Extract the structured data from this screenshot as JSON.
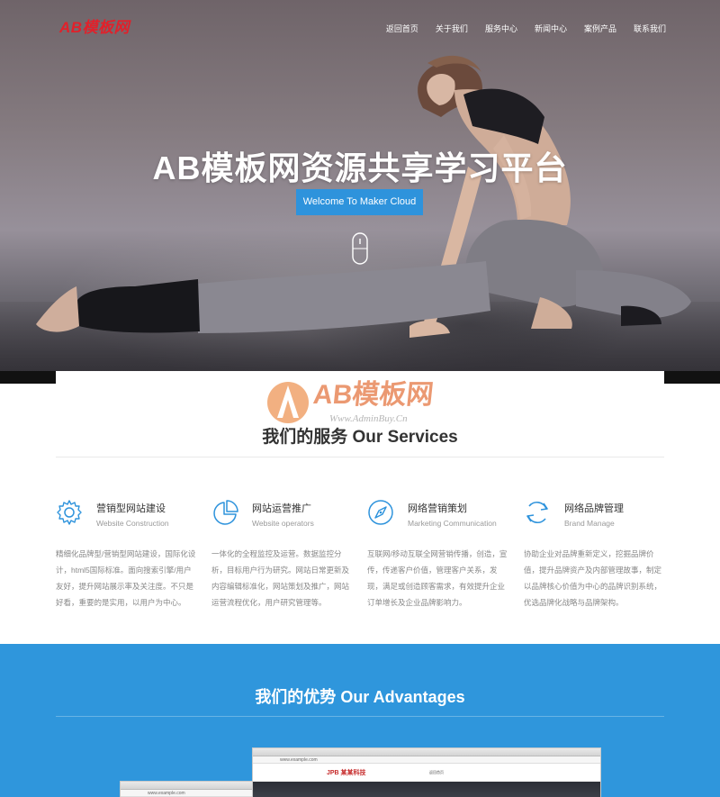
{
  "header": {
    "logo": "AB模板网",
    "nav": [
      "返回首页",
      "关于我们",
      "服务中心",
      "新闻中心",
      "案例产品",
      "联系我们"
    ]
  },
  "hero": {
    "title": "AB模板网资源共享学习平台",
    "button": "Welcome To Maker Cloud"
  },
  "watermark": {
    "brand": "AB模板网",
    "url": "Www.AdminBuy.Cn"
  },
  "services": {
    "title": "我们的服务 Our Services",
    "items": [
      {
        "icon": "gear-icon",
        "title": "营销型网站建设",
        "subtitle": "Website Construction",
        "desc": "精细化品牌型/营销型网站建设，国际化设计，html5国际标准。面向搜索引擎/用户友好，提升网站展示率及关注度。不只是好看，重要的是实用，以用户为中心。"
      },
      {
        "icon": "pie-chart-icon",
        "title": "网站运营推广",
        "subtitle": "Website operators",
        "desc": "一体化的全程监控及运营。数据监控分析，目标用户行为研究。网站日常更新及内容编辑标准化，网站策划及推广，网站运营流程优化，用户研究管理等。"
      },
      {
        "icon": "compass-icon",
        "title": "网络营销策划",
        "subtitle": "Marketing Communication",
        "desc": "互联网/移动互联全网营销传播，创造，宣传，传递客户价值，管理客户关系，发现，满足或创造顾客需求，有效提升企业订单增长及企业品牌影响力。"
      },
      {
        "icon": "refresh-icon",
        "title": "网络品牌管理",
        "subtitle": "Brand Manage",
        "desc": "协助企业对品牌重新定义，挖掘品牌价值，提升品牌资产及内部管理故事，制定以品牌核心价值为中心的品牌识别系统，优选品牌化战略与品牌架构。"
      }
    ]
  },
  "advantages": {
    "title": "我们的优势 Our Advantages",
    "browser_brand": "JPB 某某科技",
    "browser_url": "www.example.com"
  },
  "colors": {
    "accent": "#2e93dc",
    "logo_red": "#e2202a",
    "advantages_bg": "#2f96dc"
  }
}
